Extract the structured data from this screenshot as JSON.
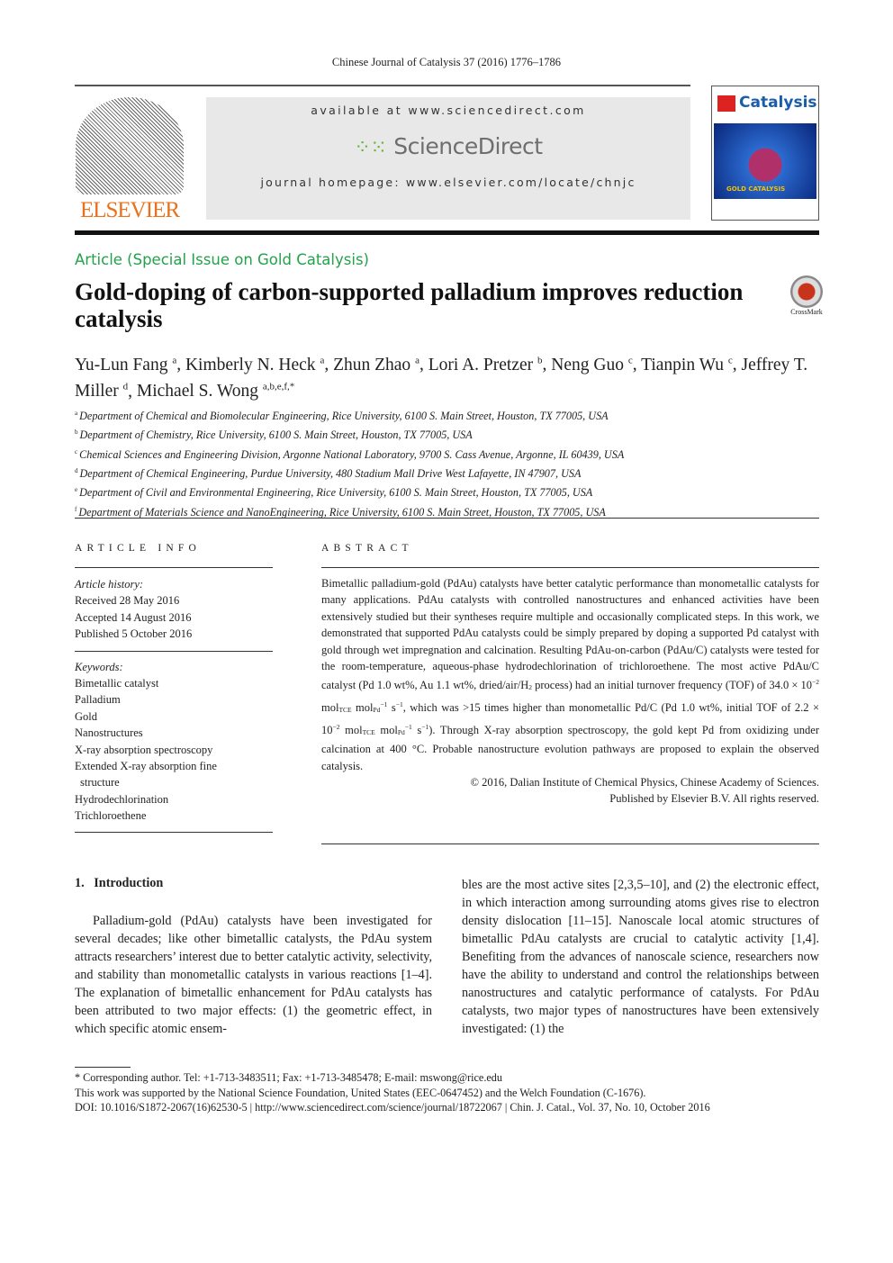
{
  "running_head": "Chinese Journal of Catalysis 37 (2016) 1776–1786",
  "publisher_logo": "ELSEVIER",
  "banner": {
    "available": "available at www.sciencedirect.com",
    "logo": "ScienceDirect",
    "homepage": "journal homepage: www.elsevier.com/locate/chnjc"
  },
  "cover": {
    "journal": "Catalysis",
    "theme": "GOLD CATALYSIS"
  },
  "article_type": "Article (Special Issue on Gold Catalysis)",
  "title": "Gold-doping of carbon-supported palladium improves reduction catalysis",
  "crossmark": "CrossMark",
  "authors": [
    {
      "name": "Yu-Lun Fang",
      "sup": "a"
    },
    {
      "name": "Kimberly N. Heck",
      "sup": "a"
    },
    {
      "name": "Zhun Zhao",
      "sup": "a"
    },
    {
      "name": "Lori A. Pretzer",
      "sup": "b"
    },
    {
      "name": "Neng Guo",
      "sup": "c"
    },
    {
      "name": "Tianpin Wu",
      "sup": "c"
    },
    {
      "name": "Jeffrey T. Miller",
      "sup": "d"
    },
    {
      "name": "Michael S. Wong",
      "sup": "a,b,e,f,*"
    }
  ],
  "affiliations": [
    {
      "sup": "a",
      "text": "Department of Chemical and Biomolecular Engineering, Rice University, 6100 S. Main Street, Houston, TX 77005, USA"
    },
    {
      "sup": "b",
      "text": "Department of Chemistry, Rice University, 6100 S. Main Street, Houston, TX 77005, USA"
    },
    {
      "sup": "c",
      "text": "Chemical Sciences and Engineering Division, Argonne National Laboratory, 9700 S. Cass Avenue, Argonne, IL 60439, USA"
    },
    {
      "sup": "d",
      "text": "Department of Chemical Engineering, Purdue University, 480 Stadium Mall Drive West Lafayette, IN 47907, USA"
    },
    {
      "sup": "e",
      "text": "Department of Civil and Environmental Engineering, Rice University, 6100 S. Main Street, Houston, TX 77005, USA"
    },
    {
      "sup": "f",
      "text": "Department of Materials Science and NanoEngineering, Rice University, 6100 S. Main Street, Houston, TX 77005, USA"
    }
  ],
  "article_info": {
    "heading": "ARTICLE INFO",
    "history_label": "Article history:",
    "history": [
      "Received 28 May 2016",
      "Accepted 14 August 2016",
      "Published 5 October 2016"
    ],
    "keywords_label": "Keywords:",
    "keywords": [
      "Bimetallic catalyst",
      "Palladium",
      "Gold",
      "Nanostructures",
      "X-ray absorption spectroscopy",
      "Extended X-ray absorption fine",
      "structure",
      "Hydrodechlorination",
      "Trichloroethene"
    ]
  },
  "abstract": {
    "heading": "ABSTRACT",
    "p1": "Bimetallic palladium-gold (PdAu) catalysts have better catalytic performance than monometallic catalysts for many applications. PdAu catalysts with controlled nanostructures and enhanced activities have been extensively studied but their syntheses require multiple and occasionally complicated steps. In this work, we demonstrated that supported PdAu catalysts could be simply prepared by doping a supported Pd catalyst with gold through wet impregnation and calcination. Resulting PdAu-on-carbon (PdAu/C) catalysts were tested for the room-temperature, aqueous-phase hydrodechlorination of trichloroethene. The most active PdAu/C catalyst (Pd 1.0 wt%, Au 1.1 wt%, dried/air/H",
    "sub_2": "2",
    "p2": " process) had an initial turnover frequency (TOF) of 34.0 × 10",
    "exp": "−2",
    "mol": " mol",
    "tce": "TCE",
    "pd": "Pd",
    "neg1": "−1",
    "s": " s",
    "p3": ", which was >15 times higher than monometallic Pd/C (Pd 1.0 wt%, initial TOF of 2.2 × 10",
    "p4": "). Through X-ray absorption spectroscopy, the gold kept Pd from oxidizing under calcination at 400 °C. Probable nanostructure evolution pathways are proposed to explain the observed catalysis.",
    "copyright1": "© 2016, Dalian Institute of Chemical Physics, Chinese Academy of Sciences.",
    "copyright2": "Published by Elsevier B.V. All rights reserved."
  },
  "intro": {
    "heading": "1.   Introduction",
    "col1": "Palladium-gold (PdAu) catalysts have been investigated for several decades; like other bimetallic catalysts, the PdAu system attracts researchers’ interest due to better catalytic activity, selectivity, and stability than monometallic catalysts in various reactions [1–4]. The explanation of bimetallic enhancement for PdAu catalysts has been attributed to two major effects: (1) the geometric effect, in which specific atomic ensem-",
    "col2": "bles are the most active sites [2,3,5–10], and (2) the electronic effect, in which interaction among surrounding atoms gives rise to electron density dislocation [11–15]. Nanoscale local atomic structures of bimetallic PdAu catalysts are crucial to catalytic activity [1,4]. Benefiting from the advances of nanoscale science, researchers now have the ability to understand and control the relationships between nanostructures and catalytic performance of catalysts. For PdAu catalysts, two major types of nanostructures have been extensively investigated: (1) the"
  },
  "footnotes": [
    "* Corresponding author. Tel: +1-713-3483511; Fax: +1-713-3485478; E-mail: mswong@rice.edu",
    "This work was supported by the National Science Foundation, United States (EEC-0647452) and the Welch Foundation (C-1676).",
    "DOI: 10.1016/S1872-2067(16)62530-5 | http://www.sciencedirect.com/science/journal/18722067 | Chin. J. Catal., Vol. 37, No. 10, October 2016"
  ],
  "colors": {
    "elsevier": "#e9711c",
    "sciencedirect_green": "#67b23b",
    "article_type": "#23a24a"
  }
}
